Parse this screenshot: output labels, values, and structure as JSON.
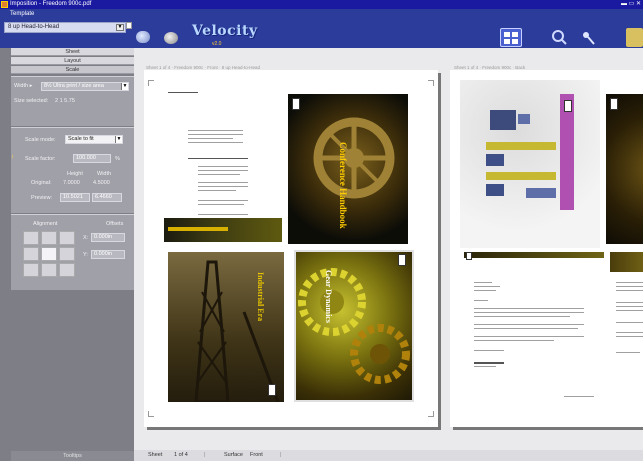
{
  "window": {
    "title": "Imposition - Freedom 900c.pdf",
    "controls": "▬ ▭ ✕"
  },
  "toolbar": {
    "template_label": "Template",
    "template_value": "8 up Head-to-Head",
    "brand_name": "Velocity",
    "brand_subtitle": "v2.0"
  },
  "left_panel": {
    "tabs": [
      "Sheet",
      "Layout",
      "Scale"
    ],
    "sheet_section": {
      "fields": [
        {
          "label": "Width ▸",
          "value": "8½ Ultra print / size area"
        },
        {
          "label": "Size selected:",
          "value": "2 1 5.75"
        }
      ]
    },
    "scale_section": {
      "scale_mode_label": "Scale mode:",
      "scale_mode_value": "Scale to fit",
      "scale_factor_label": "Scale factor:",
      "scale_factor_value": "100.000",
      "scale_factor_unit": "%",
      "col_height": "Height",
      "col_width": "Width",
      "original_label": "Original:",
      "original_height": "7.0000",
      "original_width": "4.5000",
      "preview_label": "Preview:",
      "preview_height": "10.5021",
      "preview_width": "6.4660"
    },
    "alignment": {
      "alignment_label": "Alignment",
      "offsets_label": "Offsets",
      "x_label": "X:",
      "x_value": "0.000in",
      "y_label": "Y:",
      "y_value": "0.000in"
    },
    "footer_label": "Tooltips"
  },
  "workspace": {
    "sheet1_header": "Sheet 1 of 4 · Freedom 900c · Front · 8 up Head-to-Head",
    "sheet2_header": "Sheet 1 of 4 · Freedom 900c · Back",
    "pages": {
      "gear_title": "Conference Handbook",
      "brochure_title": "Industrial Era",
      "bottom_title": "Gear Dynamics"
    }
  },
  "status": {
    "sheet_label": "Sheet",
    "sheet_value": "1 of 4",
    "surface_label": "Surface",
    "surface_value": "Front"
  },
  "colors": {
    "titlebar": "#1a1aa0",
    "toolbar": "#2c3c9a",
    "panel": "#7e7e86",
    "accent_purple": "#b050b0"
  }
}
